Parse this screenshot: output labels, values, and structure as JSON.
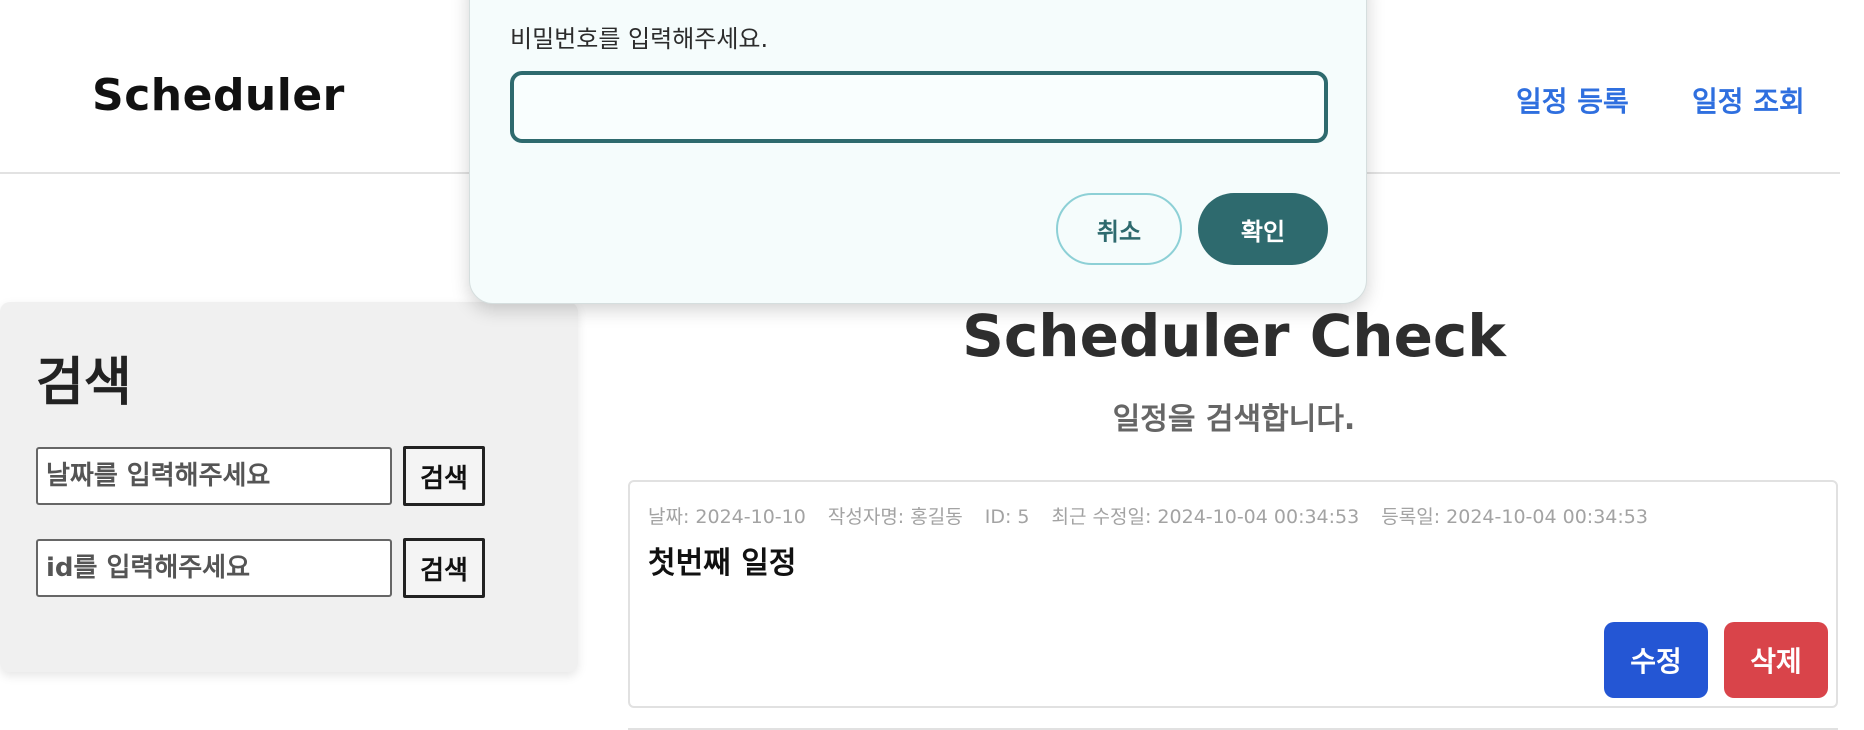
{
  "header": {
    "brand": "Scheduler",
    "nav": {
      "register": "일정 등록",
      "check": "일정 조회"
    }
  },
  "sidebar": {
    "title": "검색",
    "date_search": {
      "placeholder": "날짜를 입력해주세요",
      "button": "검색"
    },
    "id_search": {
      "placeholder": "id를 입력해주세요",
      "button": "검색"
    }
  },
  "main": {
    "title": "Scheduler Check",
    "subtitle": "일정을 검색합니다.",
    "schedules": [
      {
        "date": "날짜: 2024-10-10",
        "author": "작성자명: 홍길동",
        "id": "ID: 5",
        "updated": "최근 수정일: 2024-10-04 00:34:53",
        "created": "등록일: 2024-10-04 00:34:53",
        "title": "첫번째 일정",
        "edit_label": "수정",
        "delete_label": "삭제"
      }
    ]
  },
  "modal": {
    "label": "비밀번호를 입력해주세요.",
    "input_value": "",
    "cancel_label": "취소",
    "confirm_label": "확인"
  },
  "colors": {
    "nav_link": "#2f6fdf",
    "edit_button": "#2456d4",
    "delete_button": "#d9444a",
    "modal_accent": "#2e6a6e",
    "modal_cancel_border": "#8dd0d6"
  }
}
